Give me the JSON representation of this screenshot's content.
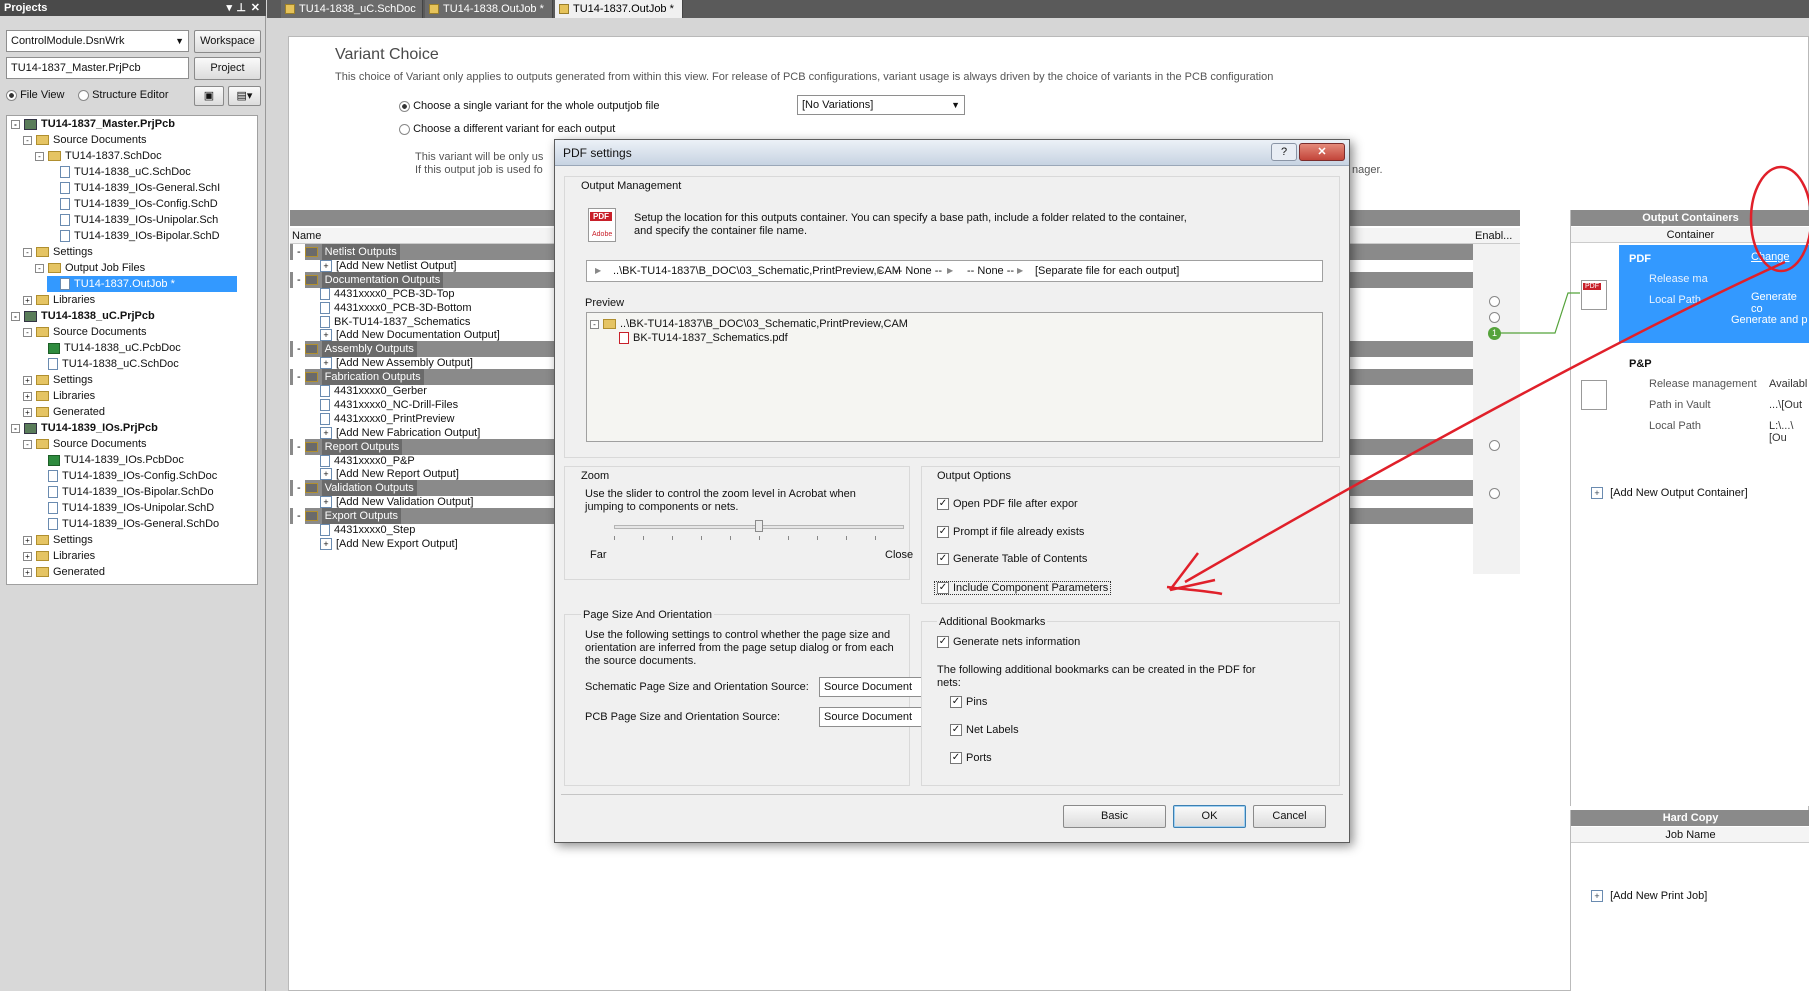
{
  "projects_panel": {
    "title": "Projects",
    "workspace_combo": "ControlModule.DsnWrk",
    "workspace_button": "Workspace",
    "project_field": "TU14-1837_Master.PrjPcb",
    "project_button": "Project",
    "file_view": "File View",
    "structure_editor": "Structure Editor",
    "tree": [
      {
        "text": "TU14-1837_Master.PrjPcb",
        "level": 0,
        "icon": "project",
        "bold": true,
        "exp": "-"
      },
      {
        "text": "Source Documents",
        "level": 1,
        "icon": "folder",
        "exp": "-"
      },
      {
        "text": "TU14-1837.SchDoc",
        "level": 2,
        "icon": "folder",
        "exp": "-"
      },
      {
        "text": "TU14-1838_uC.SchDoc",
        "level": 3,
        "icon": "doc"
      },
      {
        "text": "TU14-1839_IOs-General.SchI",
        "level": 3,
        "icon": "doc"
      },
      {
        "text": "TU14-1839_IOs-Config.SchD",
        "level": 3,
        "icon": "doc"
      },
      {
        "text": "TU14-1839_IOs-Unipolar.Sch",
        "level": 3,
        "icon": "doc"
      },
      {
        "text": "TU14-1839_IOs-Bipolar.SchD",
        "level": 3,
        "icon": "doc"
      },
      {
        "text": "Settings",
        "level": 1,
        "icon": "folder",
        "exp": "-"
      },
      {
        "text": "Output Job Files",
        "level": 2,
        "icon": "folder",
        "exp": "-"
      },
      {
        "text": "TU14-1837.OutJob *",
        "level": 3,
        "icon": "doc",
        "selected": true
      },
      {
        "text": "Libraries",
        "level": 1,
        "icon": "folder",
        "exp": "+"
      },
      {
        "text": "TU14-1838_uC.PrjPcb",
        "level": 0,
        "icon": "project",
        "bold": true,
        "exp": "-"
      },
      {
        "text": "Source Documents",
        "level": 1,
        "icon": "folder",
        "exp": "-"
      },
      {
        "text": "TU14-1838_uC.PcbDoc",
        "level": 2,
        "icon": "pcb"
      },
      {
        "text": "TU14-1838_uC.SchDoc",
        "level": 2,
        "icon": "doc"
      },
      {
        "text": "Settings",
        "level": 1,
        "icon": "folder",
        "exp": "+"
      },
      {
        "text": "Libraries",
        "level": 1,
        "icon": "folder",
        "exp": "+"
      },
      {
        "text": "Generated",
        "level": 1,
        "icon": "folder",
        "exp": "+"
      },
      {
        "text": "TU14-1839_IOs.PrjPcb",
        "level": 0,
        "icon": "project",
        "bold": true,
        "exp": "-"
      },
      {
        "text": "Source Documents",
        "level": 1,
        "icon": "folder",
        "exp": "-"
      },
      {
        "text": "TU14-1839_IOs.PcbDoc",
        "level": 2,
        "icon": "pcb"
      },
      {
        "text": "TU14-1839_IOs-Config.SchDoc",
        "level": 2,
        "icon": "doc"
      },
      {
        "text": "TU14-1839_IOs-Bipolar.SchDo",
        "level": 2,
        "icon": "doc"
      },
      {
        "text": "TU14-1839_IOs-Unipolar.SchD",
        "level": 2,
        "icon": "doc"
      },
      {
        "text": "TU14-1839_IOs-General.SchDo",
        "level": 2,
        "icon": "doc"
      },
      {
        "text": "Settings",
        "level": 1,
        "icon": "folder",
        "exp": "+"
      },
      {
        "text": "Libraries",
        "level": 1,
        "icon": "folder",
        "exp": "+"
      },
      {
        "text": "Generated",
        "level": 1,
        "icon": "folder",
        "exp": "+"
      }
    ]
  },
  "tabs": [
    "TU14-1838_uC.SchDoc",
    "TU14-1838.OutJob *",
    "TU14-1837.OutJob *"
  ],
  "variant": {
    "title": "Variant Choice",
    "desc": "This choice of Variant only applies to outputs generated from within this view. For release of PCB configurations, variant usage is always driven by the choice of variants in the PCB configuration",
    "opt_single": "Choose a single variant for the whole outputjob file",
    "opt_different": "Choose a different variant for each output",
    "variant_combo": "[No Variations]",
    "note1": "This variant will be only us",
    "note2": "If this output job is used fo",
    "note_tail": "nager."
  },
  "outputs": {
    "name_col": "Name",
    "enable_col": "Enabl...",
    "rows": [
      {
        "type": "group",
        "text": "Netlist Outputs"
      },
      {
        "type": "add",
        "text": "[Add New Netlist Output]"
      },
      {
        "type": "group",
        "text": "Documentation Outputs"
      },
      {
        "type": "item",
        "text": "4431xxxx0_PCB-3D-Top"
      },
      {
        "type": "item",
        "text": "4431xxxx0_PCB-3D-Bottom"
      },
      {
        "type": "item",
        "text": "BK-TU14-1837_Schematics"
      },
      {
        "type": "add",
        "text": "[Add New Documentation Output]"
      },
      {
        "type": "group",
        "text": "Assembly Outputs"
      },
      {
        "type": "add",
        "text": "[Add New Assembly Output]"
      },
      {
        "type": "group",
        "text": "Fabrication Outputs"
      },
      {
        "type": "item",
        "text": "4431xxxx0_Gerber"
      },
      {
        "type": "item",
        "text": "4431xxxx0_NC-Drill-Files"
      },
      {
        "type": "item",
        "text": "4431xxxx0_PrintPreview"
      },
      {
        "type": "add",
        "text": "[Add New Fabrication Output]"
      },
      {
        "type": "group",
        "text": "Report Outputs"
      },
      {
        "type": "item",
        "text": "4431xxxx0_P&P"
      },
      {
        "type": "add",
        "text": "[Add New Report Output]"
      },
      {
        "type": "group",
        "text": "Validation Outputs"
      },
      {
        "type": "add",
        "text": "[Add New Validation Output]"
      },
      {
        "type": "group",
        "text": "Export Outputs"
      },
      {
        "type": "item",
        "text": "4431xxxx0_Step"
      },
      {
        "type": "add",
        "text": "[Add New Export Output]"
      }
    ],
    "enabled_marker": "1"
  },
  "containers": {
    "title": "Output Containers",
    "col": "Container",
    "pdf": {
      "name": "PDF",
      "change": "Change",
      "release": "Release ma",
      "local": "Local Path",
      "gen1": "Generate co",
      "gen2": "Generate and p"
    },
    "pp": {
      "name": "P&P",
      "release": "Release management",
      "release_val": "Availabl",
      "vault": "Path in Vault",
      "vault_val": "...\\[Out",
      "local": "Local Path",
      "local_val": "L:\\...\\[Ou"
    },
    "add": "[Add New Output Container]"
  },
  "hardcopy": {
    "title": "Hard Copy",
    "col": "Job Name",
    "add": "[Add New Print Job]"
  },
  "dialog": {
    "title": "PDF settings",
    "help": "?",
    "close": "✕",
    "om_title": "Output Management",
    "om_desc1": "Setup the location for this outputs container. You can specify a base path, include a folder related to the container,",
    "om_desc2": "and specify the container file name.",
    "path_parts": [
      "..\\BK-TU14-1837\\B_DOC\\03_Schematic,PrintPreview,CAM",
      "-- None --",
      "-- None --",
      "[Separate file for each output]"
    ],
    "preview_title": "Preview",
    "preview_folder": "..\\BK-TU14-1837\\B_DOC\\03_Schematic,PrintPreview,CAM",
    "preview_file": "BK-TU14-1837_Schematics.pdf",
    "zoom_title": "Zoom",
    "zoom_desc": "Use the slider to control the zoom level in Acrobat when jumping to components or nets.",
    "zoom_far": "Far",
    "zoom_close": "Close",
    "zoom_level": 0.5,
    "opts_title": "Output Options",
    "opts": [
      {
        "label": "Open PDF file after expor",
        "checked": true
      },
      {
        "label": "Prompt if file already exists",
        "checked": true
      },
      {
        "label": "Generate Table of Contents",
        "checked": true
      },
      {
        "label": "Include Component Parameters",
        "checked": true
      }
    ],
    "page_title": "Page Size And Orientation",
    "page_desc": "Use the following settings to control whether the page size and orientation are inferred from the page setup dialog or from each the source documents.",
    "sch_label": "Schematic Page Size and Orientation Source:",
    "sch_value": "Source Document",
    "pcb_label": "PCB Page Size and Orientation Source:",
    "pcb_value": "Source Document",
    "bm_title": "Additional Bookmarks",
    "bm_gen": "Generate nets information",
    "bm_desc": "The following additional bookmarks can be created in the PDF for nets:",
    "bm_opts": [
      {
        "label": "Pins",
        "checked": true
      },
      {
        "label": "Net Labels",
        "checked": true
      },
      {
        "label": "Ports",
        "checked": true
      }
    ],
    "basic": "Basic",
    "ok": "OK",
    "cancel": "Cancel"
  },
  "pdf_icon_text": "PDF",
  "pdf_icon_sub": "Adobe",
  "annotation_color": "#e0202a",
  "accent_color": "#3399ff"
}
